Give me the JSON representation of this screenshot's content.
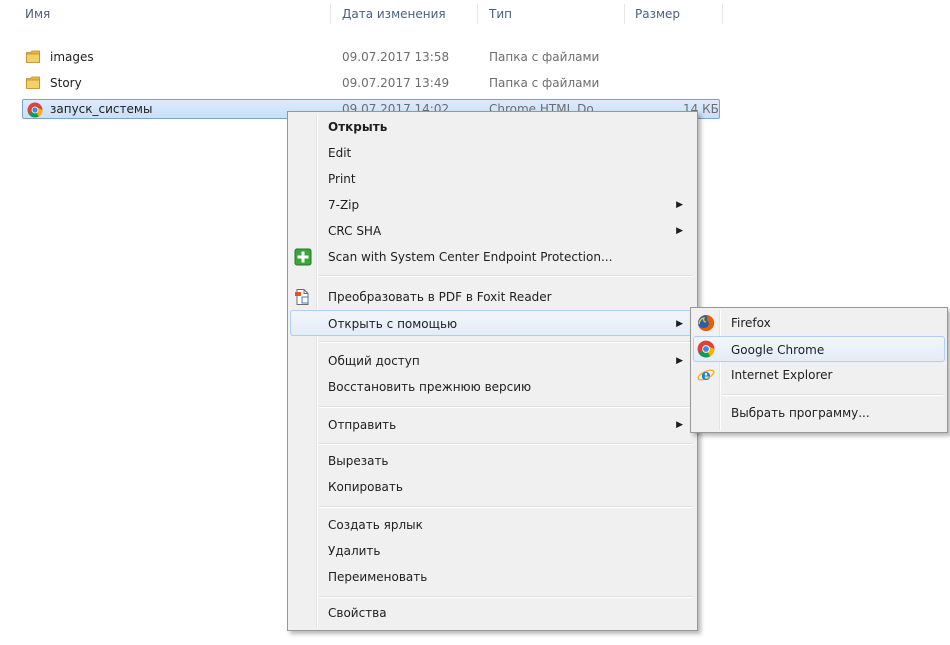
{
  "columns": {
    "name": "Имя",
    "date": "Дата изменения",
    "type": "Тип",
    "size": "Размер"
  },
  "files": [
    {
      "name": "images",
      "date": "09.07.2017 13:58",
      "type": "Папка с файлами",
      "size": "",
      "icon": "folder-icon"
    },
    {
      "name": "Story",
      "date": "09.07.2017 13:49",
      "type": "Папка с файлами",
      "size": "",
      "icon": "folder-icon"
    },
    {
      "name": "запуск_системы",
      "date": "09.07.2017 14:02",
      "type": "Chrome HTML Do...",
      "size": "14 КБ",
      "icon": "chrome-icon",
      "selected": true
    }
  ],
  "context_menu": {
    "items": [
      {
        "label": "Открыть",
        "bold": true
      },
      {
        "label": "Edit"
      },
      {
        "label": "Print"
      },
      {
        "label": "7-Zip",
        "submenu": true
      },
      {
        "label": "CRC SHA",
        "submenu": true
      },
      {
        "label": "Scan with System Center Endpoint Protection...",
        "icon": "endpoint-protection-icon"
      },
      {
        "label": "Преобразовать в PDF в Foxit Reader",
        "icon": "foxit-pdf-icon"
      },
      {
        "label": "Открыть с помощью",
        "submenu": true,
        "highlighted": true
      },
      {
        "label": "Общий доступ",
        "submenu": true
      },
      {
        "label": "Восстановить прежнюю версию"
      },
      {
        "label": "Отправить",
        "submenu": true
      },
      {
        "label": "Вырезать"
      },
      {
        "label": "Копировать"
      },
      {
        "label": "Создать ярлык"
      },
      {
        "label": "Удалить"
      },
      {
        "label": "Переименовать"
      },
      {
        "label": "Свойства"
      }
    ]
  },
  "open_with_submenu": {
    "items": [
      {
        "label": "Firefox",
        "icon": "firefox-icon"
      },
      {
        "label": "Google Chrome",
        "icon": "chrome-icon",
        "highlighted": true
      },
      {
        "label": "Internet Explorer",
        "icon": "internet-explorer-icon"
      },
      {
        "label": "Выбрать программу..."
      }
    ]
  },
  "colors": {
    "selection": "#cce4fb",
    "menu_bg": "#f0f0f0",
    "header_text": "#4c607a"
  }
}
